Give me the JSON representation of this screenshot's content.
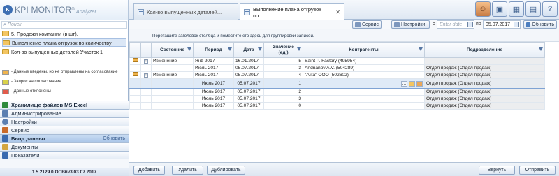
{
  "app": {
    "brand": "KPI MONITOR",
    "registered": "®",
    "subtitle": "Analyzer",
    "logo_letter": "K"
  },
  "tabs": [
    {
      "label": "Кол-во выпущенных деталей...",
      "active": false
    },
    {
      "label": "Выполнение плана отгрузок по...",
      "active": true
    }
  ],
  "header_icons": [
    "user-avatar-icon",
    "window-icon",
    "modules-icon",
    "calendar-icon",
    "help-icon"
  ],
  "sidebar": {
    "search_placeholder": "Поиск",
    "tree": [
      {
        "label": "5. Продажи компании (в шт).",
        "selected": false
      },
      {
        "label": "Выполнение плана отгрузок по количеству",
        "selected": true
      },
      {
        "label": "Кол-во выпущенных деталей Участок 1",
        "selected": false
      }
    ],
    "legend": [
      {
        "label": "- Данные введены, но не отправлены на согласование",
        "color": "#f0b44c"
      },
      {
        "label": "- Запрос на согласование",
        "color": "#d9d24a"
      },
      {
        "label": "- Данные отклонены",
        "color": "#e25b4b"
      }
    ],
    "sections": [
      {
        "label": "Хранилище файлов MS Excel",
        "icon_color": "#2f8a3c",
        "active": false,
        "right": ""
      },
      {
        "label": "Администрирование",
        "icon_color": "#5b7fb1",
        "active": false,
        "right": ""
      },
      {
        "label": "Настройки",
        "icon_color": "#5b7fb1",
        "active": false,
        "right": ""
      },
      {
        "label": "Сервис",
        "icon_color": "#c96b2b",
        "active": false,
        "right": ""
      },
      {
        "label": "Ввод данных",
        "icon_color": "#3a6bb0",
        "active": true,
        "right": "Обновить"
      },
      {
        "label": "Документы",
        "icon_color": "#d4a640",
        "active": false,
        "right": ""
      },
      {
        "label": "Показатели",
        "icon_color": "#3a6bb0",
        "active": false,
        "right": ""
      }
    ],
    "version": "1.5.2129.0.OCB6v3  03.07.2017"
  },
  "toolbar": {
    "service": "Сервис",
    "settings": "Настройки",
    "from_label": "с",
    "from_placeholder": "Enter date",
    "to_label": "по",
    "to_value": "05.07.2017",
    "refresh": "Обновить"
  },
  "group_hint": "Перетащите заголовок столбца и поместите его здесь для группировки записей.",
  "grid": {
    "columns": [
      "",
      "",
      "Состояние",
      "Период",
      "Дата",
      "Значение (ед.)",
      "Контрагенты",
      "Подразделение"
    ],
    "rows": [
      {
        "flag": true,
        "expand": true,
        "state": "Изменение",
        "period": "Янв 2017",
        "date": "16.01.2017",
        "value": "5",
        "contractor": "Saint P. Factory (495954)",
        "division": "",
        "editing": false
      },
      {
        "flag": false,
        "expand": false,
        "state": "",
        "period": "Июль 2017",
        "date": "05.07.2017",
        "value": "3",
        "contractor": "Andrianov A.V. (504289)",
        "division": "Отдел продаж (Отдел продаж)",
        "editing": false
      },
      {
        "flag": true,
        "expand": true,
        "state": "Изменение",
        "period": "Июль 2017",
        "date": "05.07.2017",
        "value": "4",
        "contractor": "\"Alita\" ООО (502602)",
        "division": "Отдел продаж (Отдел продаж)",
        "editing": false
      },
      {
        "flag": false,
        "expand": false,
        "state": "",
        "period": "Июль 2017",
        "date": "05.07.2017",
        "value": "1",
        "contractor": "",
        "division": "Отдел продаж (Отдел продаж)",
        "editing": true
      },
      {
        "flag": false,
        "expand": false,
        "state": "",
        "period": "Июль 2017",
        "date": "05.07.2017",
        "value": "2",
        "contractor": "",
        "division": "Отдел продаж (Отдел продаж)",
        "editing": false
      },
      {
        "flag": false,
        "expand": false,
        "state": "",
        "period": "Июль 2017",
        "date": "05.07.2017",
        "value": "3",
        "contractor": "",
        "division": "Отдел продаж (Отдел продаж)",
        "editing": false
      },
      {
        "flag": false,
        "expand": false,
        "state": "",
        "period": "Июль 2017",
        "date": "05.07.2017",
        "value": "0",
        "contractor": "",
        "division": "Отдел продаж (Отдел продаж)",
        "editing": false
      }
    ]
  },
  "footer": {
    "add": "Добавить",
    "delete": "Удалить",
    "duplicate": "Дублировать",
    "return": "Вернуть",
    "send": "Отправить"
  }
}
